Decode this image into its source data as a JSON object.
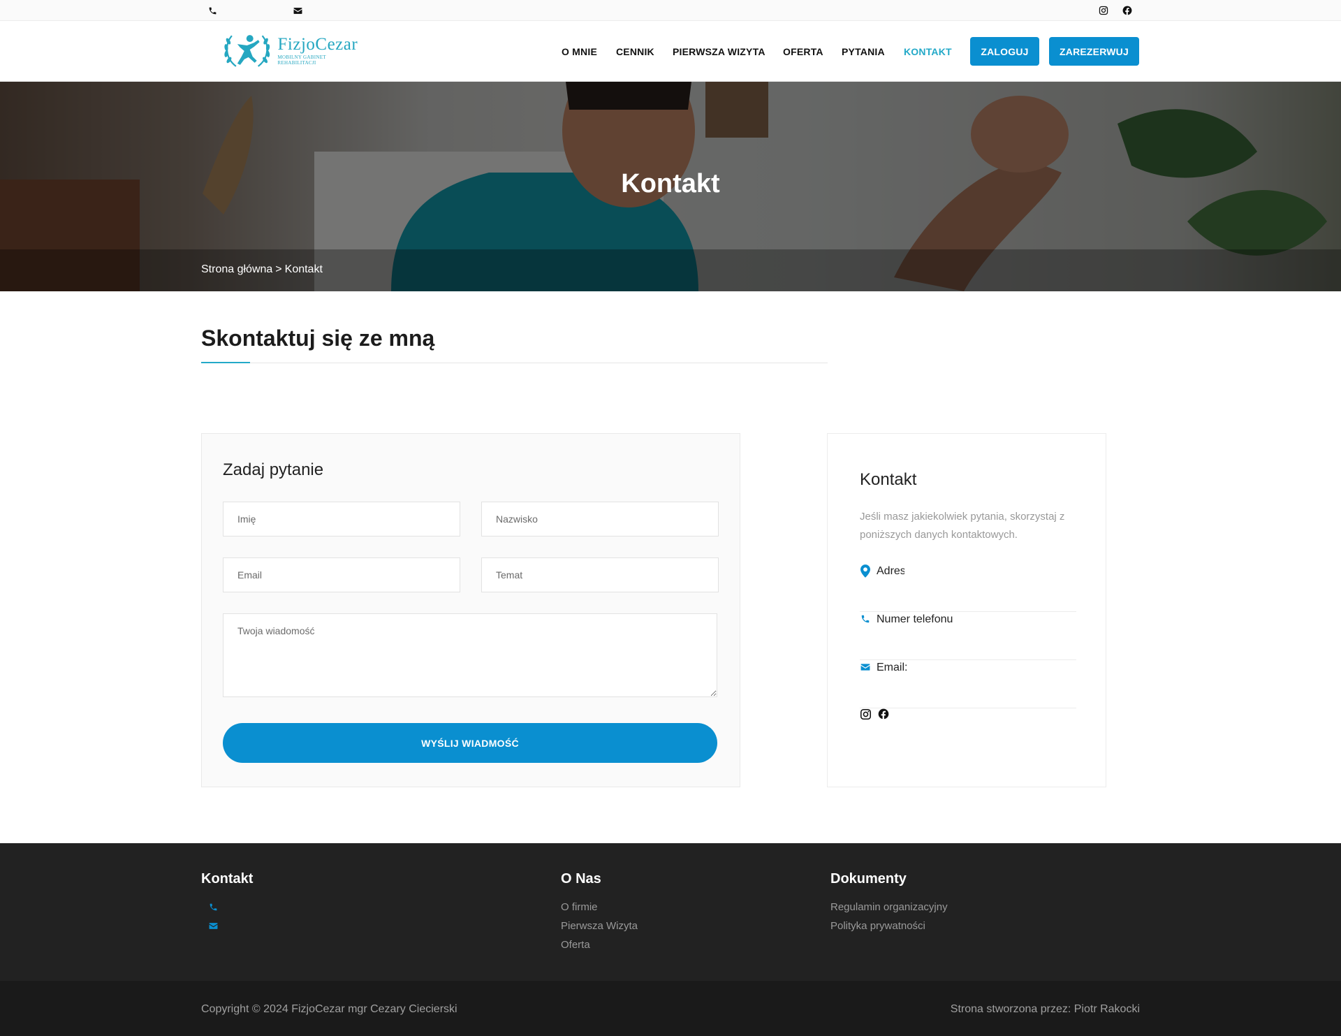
{
  "topbar": {
    "icons": [
      "phone-icon",
      "envelope-icon",
      "instagram-icon",
      "facebook-icon"
    ]
  },
  "header": {
    "logo": {
      "name": "FizjoCezar",
      "subtitle": "MOBILNY GABINET REHABILITACJI"
    },
    "nav": [
      {
        "label": "O MNIE",
        "active": false
      },
      {
        "label": "CENNIK",
        "active": false
      },
      {
        "label": "PIERWSZA WIZYTA",
        "active": false
      },
      {
        "label": "OFERTA",
        "active": false
      },
      {
        "label": "PYTANIA",
        "active": false
      },
      {
        "label": "KONTAKT",
        "active": true
      }
    ],
    "buttons": {
      "login": "ZALOGUJ",
      "book": "ZAREZERWUJ"
    }
  },
  "hero": {
    "title": "Kontakt",
    "breadcrumb": {
      "home": "Strona główna",
      "separator": ">",
      "current": "Kontakt"
    }
  },
  "section": {
    "title": "Skontaktuj się ze mną"
  },
  "form": {
    "title": "Zadaj pytanie",
    "first_name": {
      "placeholder": "Imię",
      "value": ""
    },
    "last_name": {
      "placeholder": "Nazwisko",
      "value": ""
    },
    "email": {
      "placeholder": "Email",
      "value": ""
    },
    "subject": {
      "placeholder": "Temat",
      "value": ""
    },
    "message": {
      "placeholder": "Twoja wiadomość",
      "value": ""
    },
    "submit": "WYŚLIJ WIADMOŚĆ"
  },
  "contact_card": {
    "title": "Kontakt",
    "description": "Jeśli masz jakiekolwiek pytania, skorzystaj z poniższych danych kontaktowych.",
    "items": [
      {
        "icon": "map-marker-icon",
        "label": "Adres"
      },
      {
        "icon": "phone-icon",
        "label": "Numer telefonu"
      },
      {
        "icon": "envelope-icon",
        "label": "Email:"
      }
    ],
    "social": [
      "instagram-icon",
      "facebook-icon"
    ]
  },
  "footer": {
    "columns": [
      {
        "title": "Kontakt",
        "icons": [
          "phone-icon",
          "envelope-icon"
        ]
      },
      {
        "title": "O Nas",
        "links": [
          "O firmie",
          "Pierwsza Wizyta",
          "Oferta"
        ]
      },
      {
        "title": "Dokumenty",
        "links": [
          "Regulamin organizacyjny",
          "Polityka prywatności"
        ]
      }
    ],
    "copyright": "Copyright © 2024 FizjoCezar mgr Cezary Ciecierski",
    "credit": "Strona stworzona przez: Piotr Rakocki"
  },
  "colors": {
    "accent": "#0a8fd0",
    "teal": "#23a9c8",
    "footer_bg": "#222222",
    "bottom_bg": "#1a1a1a"
  }
}
